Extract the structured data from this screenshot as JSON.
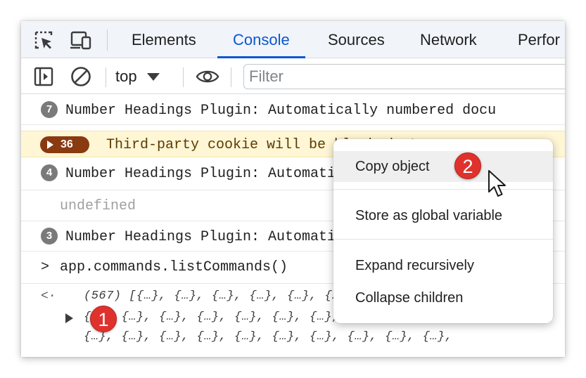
{
  "tabbar": {
    "icons": [
      "inspect-element-icon",
      "device-toolbar-icon"
    ],
    "tabs": [
      {
        "label": "Elements",
        "active": false
      },
      {
        "label": "Console",
        "active": true
      },
      {
        "label": "Sources",
        "active": false
      },
      {
        "label": "Network",
        "active": false
      },
      {
        "label": "Perfor",
        "active": false
      }
    ]
  },
  "toolbar": {
    "icons": [
      "sidebar-toggle-icon",
      "clear-console-icon",
      "eye-icon"
    ],
    "context": "top",
    "filter_placeholder": "Filter"
  },
  "console": {
    "rows": [
      {
        "count": "7",
        "text": "Number Headings Plugin: Automatically numbered docu"
      },
      {
        "count": "36",
        "text": "Third-party cookie will be blocked. Learn more",
        "type": "warning"
      },
      {
        "count": "4",
        "text": "Number Headings Plugin: Automatically numbered docu"
      },
      {
        "text": "undefined"
      },
      {
        "count": "3",
        "text": "Number Headings Plugin: Automatically numbered docu"
      }
    ],
    "input_prompt": ">",
    "input_command": "app.commands.listCommands()",
    "result_arrow": "<·",
    "result_line1": "(567) [{…}, {…}, {…}, {…}, {…}, {…}, {…}, {…}, {…}",
    "result_line2": "{…}, {…}, {…}, {…}, {…}, {…}, {…}, {…}, {…}, {…},",
    "result_line3": "{…}, {…}, {…}, {…}, {…}, {…}, {…}, {…}, {…}, {…},"
  },
  "context_menu": {
    "items": [
      "Copy object",
      "Store as global variable",
      "Expand recursively",
      "Collapse children"
    ]
  },
  "steps": [
    "1",
    "2"
  ],
  "colors": {
    "accent": "#0b57d0",
    "step_marker": "#e0322d",
    "warning_badge": "#8a3a10",
    "warning_bg": "#fef6d5"
  }
}
